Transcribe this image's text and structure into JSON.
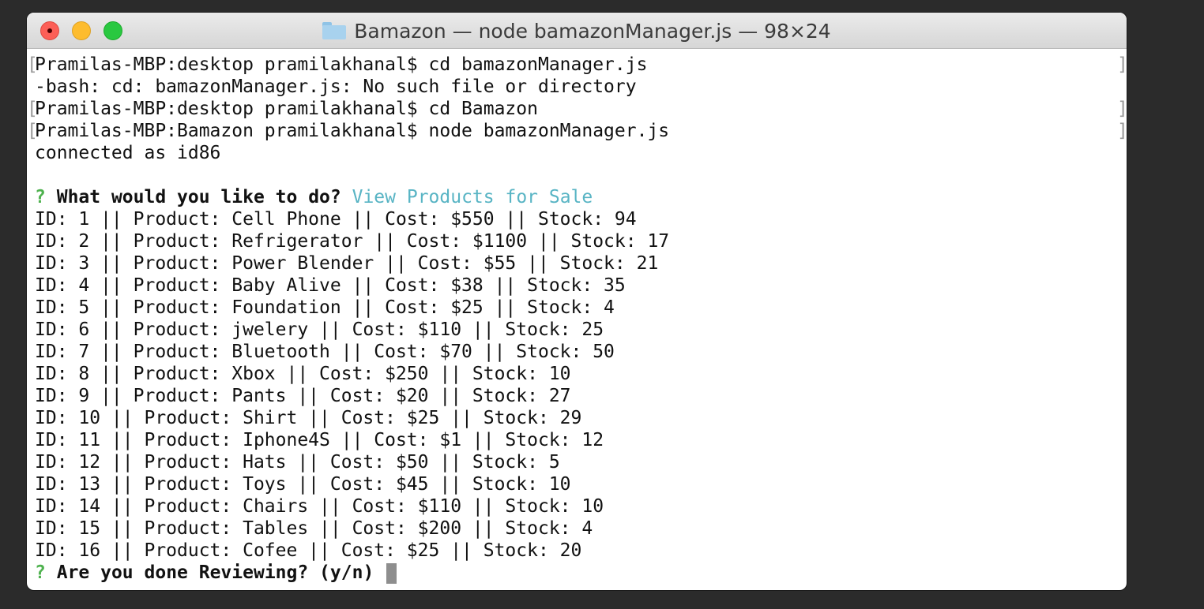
{
  "window": {
    "title": "Bamazon — node bamazonManager.js — 98×24",
    "folder_icon": "folder-icon"
  },
  "terminal": {
    "prompt_lines": [
      "Pramilas-MBP:desktop pramilakhanal$ cd bamazonManager.js",
      "-bash: cd: bamazonManager.js: No such file or directory",
      "Pramilas-MBP:desktop pramilakhanal$ cd Bamazon",
      "Pramilas-MBP:Bamazon pramilakhanal$ node bamazonManager.js",
      "connected as id86"
    ],
    "question1": {
      "mark": "?",
      "text": "What would you like to do?",
      "answer": "View Products for Sale"
    },
    "products": [
      "ID: 1 || Product: Cell Phone || Cost: $550 || Stock: 94",
      "ID: 2 || Product: Refrigerator || Cost: $1100 || Stock: 17",
      "ID: 3 || Product: Power Blender || Cost: $55 || Stock: 21",
      "ID: 4 || Product: Baby Alive || Cost: $38 || Stock: 35",
      "ID: 5 || Product: Foundation || Cost: $25 || Stock: 4",
      "ID: 6 || Product: jwelery || Cost: $110 || Stock: 25",
      "ID: 7 || Product: Bluetooth || Cost: $70 || Stock: 50",
      "ID: 8 || Product: Xbox || Cost: $250 || Stock: 10",
      "ID: 9 || Product: Pants || Cost: $20 || Stock: 27",
      "ID: 10 || Product: Shirt || Cost: $25 || Stock: 29",
      "ID: 11 || Product: Iphone4S || Cost: $1 || Stock: 12",
      "ID: 12 || Product: Hats || Cost: $50 || Stock: 5",
      "ID: 13 || Product: Toys || Cost: $45 || Stock: 10",
      "ID: 14 || Product: Chairs || Cost: $110 || Stock: 10",
      "ID: 15 || Product: Tables || Cost: $200 || Stock: 4",
      "ID: 16 || Product: Cofee || Cost: $25 || Stock: 20"
    ],
    "question2": {
      "mark": "?",
      "text": "Are you done Reviewing? (y/n)"
    }
  },
  "colors": {
    "prompt_mark": "#4fb24f",
    "answer": "#58b4c4",
    "text": "#111111",
    "background": "#ffffff"
  }
}
